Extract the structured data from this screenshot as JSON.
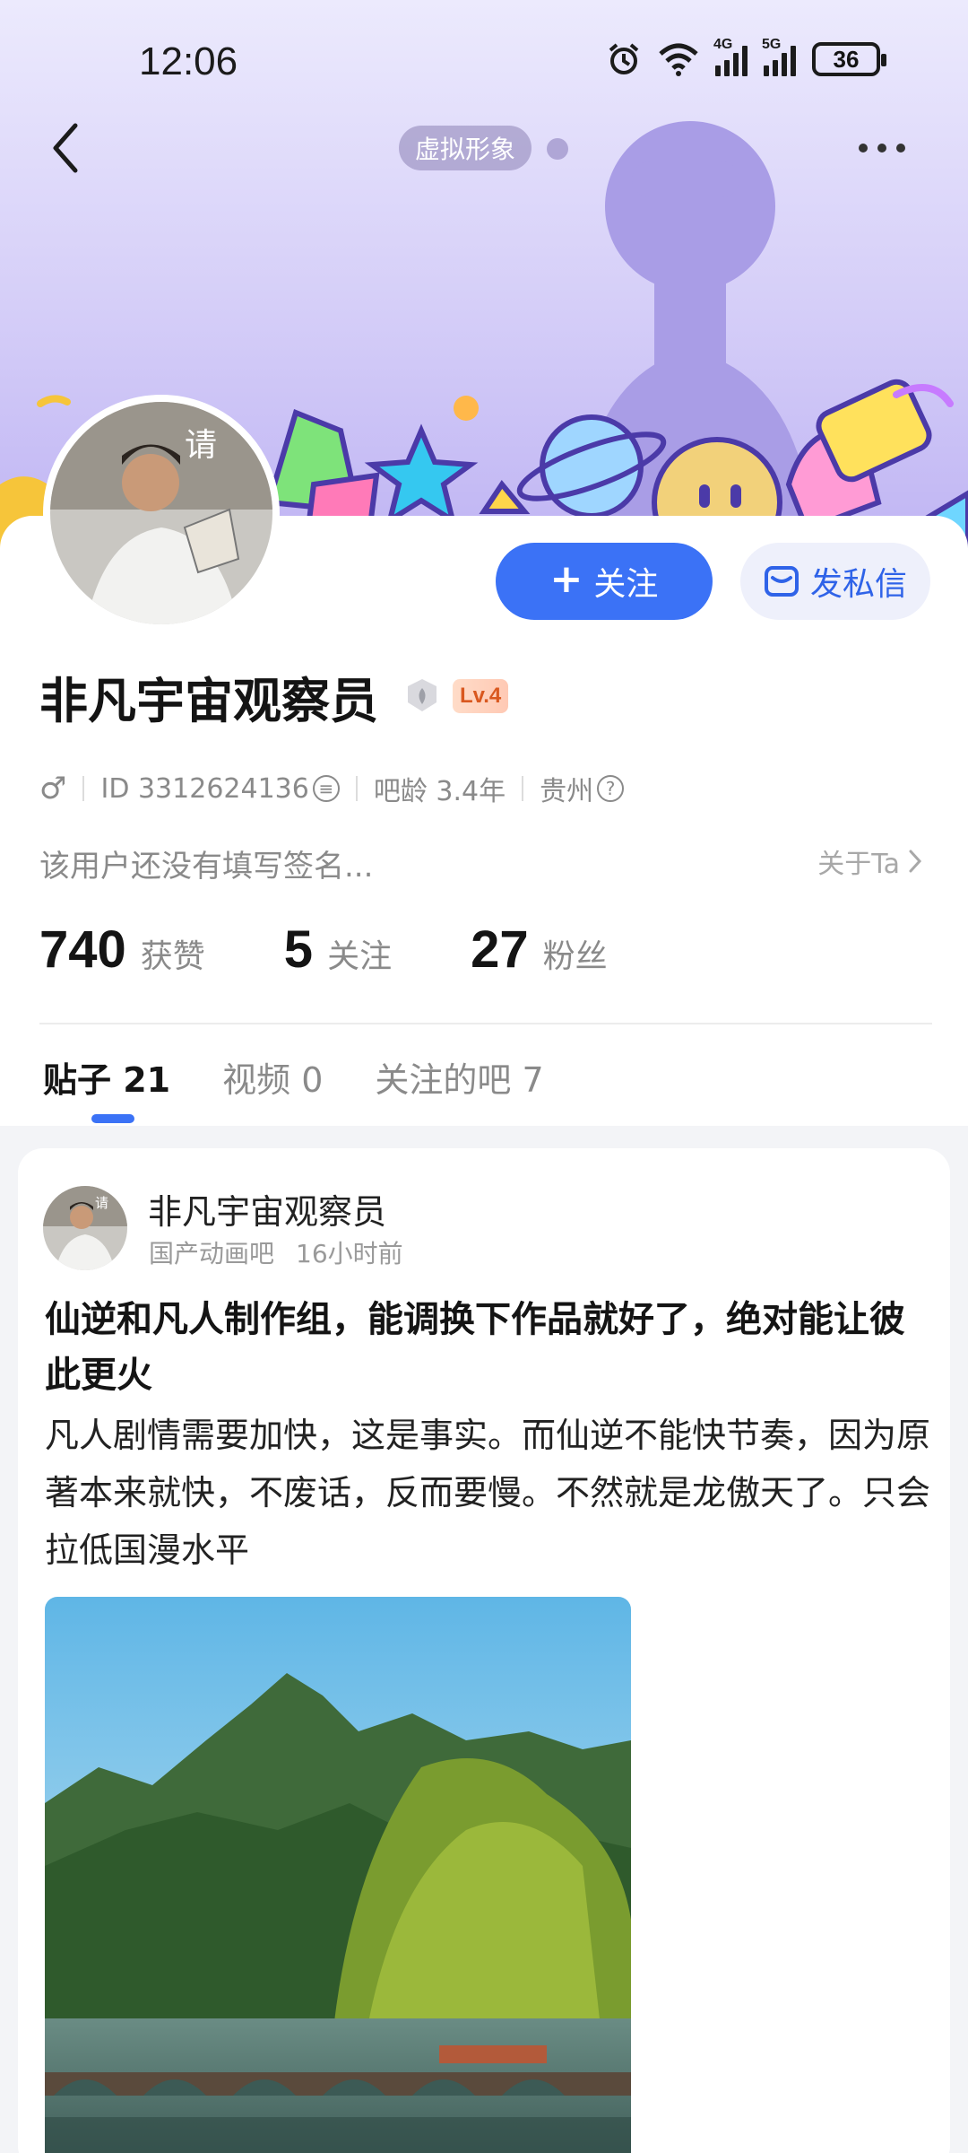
{
  "status_bar": {
    "time": "12:06",
    "net1": "4G",
    "net2": "5G",
    "battery": "36"
  },
  "nav": {
    "avatar_tag": "虚拟形象"
  },
  "profile": {
    "follow_label": "关注",
    "message_label": "发私信",
    "username": "非凡宇宙观察员",
    "level": "Lv.4",
    "gender_symbol": "♂",
    "id_text": "ID 3312624136",
    "tieba_age": "吧龄 3.4年",
    "location": "贵州",
    "signature": "该用户还没有填写签名...",
    "about": "关于Ta",
    "stats": [
      {
        "num": "740",
        "label": "获赞"
      },
      {
        "num": "5",
        "label": "关注"
      },
      {
        "num": "27",
        "label": "粉丝"
      }
    ]
  },
  "tabs": [
    {
      "label": "贴子 21",
      "active": true
    },
    {
      "label": "视频 0",
      "active": false
    },
    {
      "label": "关注的吧 7",
      "active": false
    }
  ],
  "post": {
    "author": "非凡宇宙观察员",
    "forum": "国产动画吧",
    "time": "16小时前",
    "title": "仙逆和凡人制作组，能调换下作品就好了，绝对能让彼此更火",
    "body": "凡人剧情需要加快，这是事实。而仙逆不能快节奏，因为原著本来就快，不废话，反而要慢。不然就是龙傲天了。只会拉低国漫水平"
  },
  "colors": {
    "accent": "#3b72f6",
    "banner_top": "#eceafd",
    "banner_bottom": "#bfb4f3",
    "level_badge": "#ffc9b4"
  },
  "icons": [
    "back-arrow-icon",
    "more-icon",
    "plus-icon",
    "mail-icon",
    "rank-icon",
    "copy-icon",
    "help-icon",
    "chevron-right-icon"
  ]
}
